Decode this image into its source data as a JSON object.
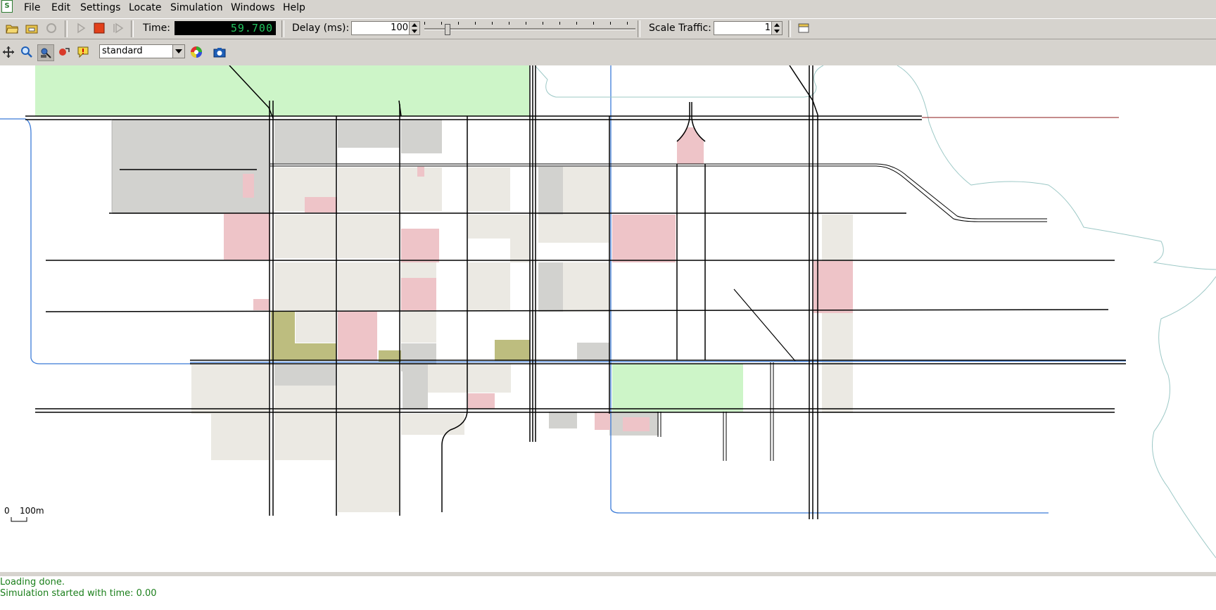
{
  "menubar": {
    "items": [
      {
        "label": "File"
      },
      {
        "label": "Edit"
      },
      {
        "label": "Settings"
      },
      {
        "label": "Locate"
      },
      {
        "label": "Simulation"
      },
      {
        "label": "Windows"
      },
      {
        "label": "Help"
      }
    ]
  },
  "toolbar": {
    "time_label": "Time:",
    "time_value": "59.700",
    "delay_label": "Delay (ms):",
    "delay_value": "100",
    "delay_slider_fraction": 0.1,
    "scale_traffic_label": "Scale Traffic:",
    "scale_traffic_value": "1"
  },
  "view_toolbar": {
    "scheme": "standard"
  },
  "map": {
    "scale_zero": "0",
    "scale_label": "100m",
    "colors": {
      "road": "#000000",
      "waterway": "#3b7bd8",
      "park": "#cdf5c8",
      "residential": "#ebe9e3",
      "industrial": "#d2d2cf",
      "commercial": "#eec4c8",
      "farmland": "#bdbd7f"
    }
  },
  "status": {
    "lines": [
      "Loading done.",
      "Simulation started with time: 0.00"
    ]
  }
}
